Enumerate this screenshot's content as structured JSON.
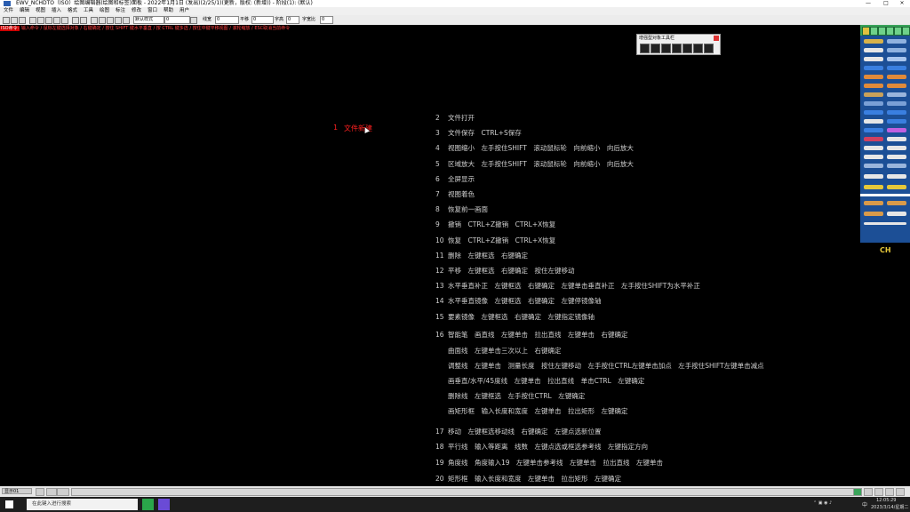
{
  "window": {
    "title": "EWV_NCHDTO（ISO）绘图编辑器(绘图和标签)面板 - 2022年1月1日 (发出)(2/25/1)(更新，版权: (新增)) - 阶段(1): (默认)",
    "controls": [
      "—",
      "□",
      "×"
    ]
  },
  "menubar": {
    "items": [
      "文件",
      "编辑",
      "视图",
      "插入",
      "格式",
      "工具",
      "绘图",
      "标注",
      "修改",
      "窗口",
      "帮助",
      "用户"
    ]
  },
  "toolbar": {
    "field1": "默认样式",
    "label2": "颜色",
    "field2": "0",
    "label3": "线宽",
    "field3": "0",
    "label4": "平移",
    "field4": "0",
    "label5": "字高",
    "field5": "0",
    "label6": "字宽比",
    "field6": "0"
  },
  "hintbar": {
    "tag": "ISO命令:",
    "text": "输入命令 / 鼠标左键选择对象 / 右键确定 / 按住 SHIFT 键水平垂直 / 按 CTRL 键多选 / 按住中键平移视图 / 滚轮缩放 / ESC取消当前命令"
  },
  "canvas": {
    "label_num": "1",
    "label_text": "文件新建"
  },
  "instructions": [
    {
      "n": "2",
      "t": "文件打开"
    },
    {
      "n": "3",
      "t": "文件保存　CTRL+S保存"
    },
    {
      "n": "4",
      "t": "视图缩小　左手按住SHIFT　滚动鼠标轮　向前缩小　向后放大"
    },
    {
      "n": "5",
      "t": "区域放大　左手按住SHIFT　滚动鼠标轮　向前缩小　向后放大"
    },
    {
      "n": "6",
      "t": "全屏显示"
    },
    {
      "n": "7",
      "t": "视图着色"
    },
    {
      "n": "8",
      "t": "恢复前一画面"
    },
    {
      "n": "9",
      "t": "撤销　CTRL+Z撤销　CTRL+X恢复"
    },
    {
      "n": "10",
      "t": "恢复　CTRL+Z撤销　CTRL+X恢复"
    },
    {
      "n": "11",
      "t": "删除　左键框选　右键确定"
    },
    {
      "n": "12",
      "t": "平移　左键框选　右键确定　按住左键移动"
    },
    {
      "n": "13",
      "t": "水平垂直补正　左键框选　右键确定　左键单击垂直补正　左手按住SHIFT为水平补正"
    },
    {
      "n": "14",
      "t": "水平垂直镜像　左键框选　右键确定　左键停镜像轴"
    },
    {
      "n": "15",
      "t": "要素镜像　左键框选　右键确定　左键指定镜像轴"
    },
    {
      "n": "16",
      "t": "智能笔　画直线　左键单击　拉出直线　左键单击　右键确定"
    },
    {
      "n": "",
      "t": "曲面线　左键单击三次以上　右键确定"
    },
    {
      "n": "",
      "t": "调整线　左键单击　测量长度　按住左键移动　左手按住CTRL左键单击加点　左手按住SHIFT左键单击减点"
    },
    {
      "n": "",
      "t": "画垂直/水平/45度线　左键单击　拉出直线　单击CTRL　左键确定"
    },
    {
      "n": "",
      "t": "删除线　左键框选　左手按住CTRL　左键确定"
    },
    {
      "n": "",
      "t": "画矩形框　输入长度和宽度　左键单击　拉出矩形　左键确定"
    },
    {
      "n": "17",
      "t": "移动　左键框选移动线　右键确定　左键点选新位置"
    },
    {
      "n": "18",
      "t": "平行线　输入等距离　线数　左键点选或框选参考线　左键指定方向"
    },
    {
      "n": "19",
      "t": "角度线　角度输入19　左键单击参考线　左键单击　拉出直线　左键单击"
    },
    {
      "n": "20",
      "t": "矩形框　输入长度和宽度　左键单击　拉出矩形　左键确定"
    }
  ],
  "floatpanel": {
    "title": "增强型对象工具栏"
  },
  "rpanel": {
    "lang": "CH"
  },
  "statusbar": {
    "mode": "显示01"
  },
  "taskbar": {
    "search_placeholder": "在此键入进行搜索",
    "time": "12:05:29",
    "date": "2023/3/14/星期二",
    "ime": "中"
  }
}
